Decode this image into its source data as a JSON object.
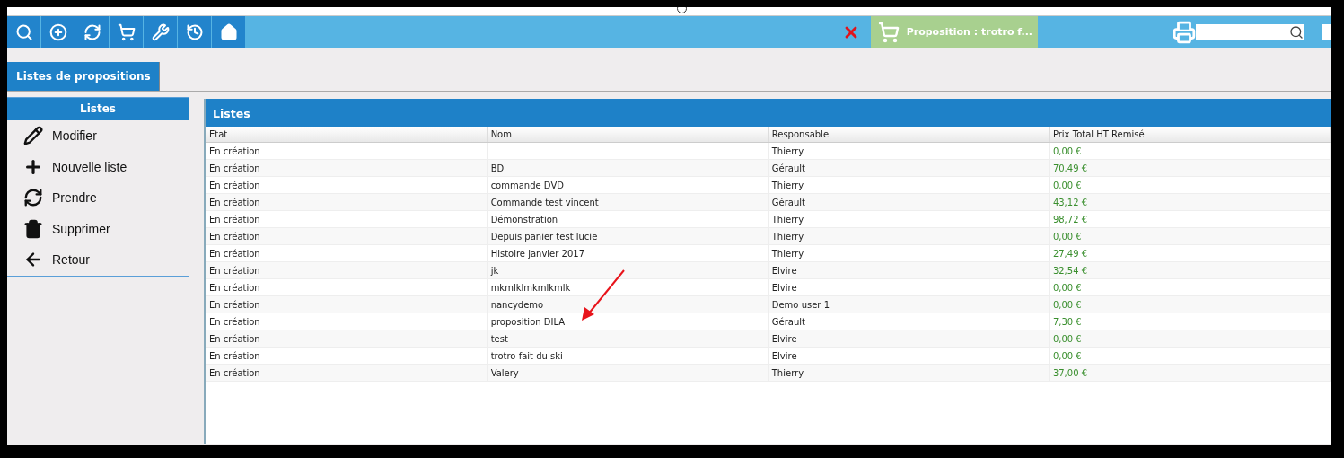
{
  "toolbar": {
    "buttons": [
      {
        "kind": "search"
      },
      {
        "kind": "add"
      },
      {
        "kind": "refresh"
      },
      {
        "kind": "cart"
      },
      {
        "kind": "tools"
      },
      {
        "kind": "history"
      },
      {
        "kind": "home"
      }
    ],
    "proposition": "Proposition : trotro f..."
  },
  "tabs": [
    {
      "label": "Listes de propositions",
      "selected": true
    }
  ],
  "sidebar": {
    "title": "Listes",
    "items": [
      {
        "kind": "edit",
        "label": "Modifier"
      },
      {
        "kind": "add",
        "label": "Nouvelle liste"
      },
      {
        "kind": "refresh",
        "label": "Prendre"
      },
      {
        "kind": "delete",
        "label": "Supprimer"
      },
      {
        "kind": "back",
        "label": "Retour"
      }
    ]
  },
  "table": {
    "title": "Listes",
    "columns": [
      "Etat",
      "Nom",
      "Responsable",
      "Prix Total HT Remisé"
    ],
    "rows": [
      [
        "En création",
        "",
        "Thierry",
        "0,00 €"
      ],
      [
        "En création",
        "BD",
        "Gérault",
        "70,49 €"
      ],
      [
        "En création",
        "commande DVD",
        "Thierry",
        "0,00 €"
      ],
      [
        "En création",
        "Commande test vincent",
        "Gérault",
        "43,12 €"
      ],
      [
        "En création",
        "Démonstration",
        "Thierry",
        "98,72 €"
      ],
      [
        "En création",
        "Depuis panier test lucie",
        "Thierry",
        "0,00 €"
      ],
      [
        "En création",
        "Histoire janvier 2017",
        "Thierry",
        "27,49 €"
      ],
      [
        "En création",
        "jk",
        "Elvire",
        "32,54 €"
      ],
      [
        "En création",
        "mkmlklmkmlkmlk",
        "Elvire",
        "0,00 €"
      ],
      [
        "En création",
        "nancydemo",
        "Demo user 1",
        "0,00 €"
      ],
      [
        "En création",
        "proposition DILA",
        "Gérault",
        "7,30 €"
      ],
      [
        "En création",
        "test",
        "Elvire",
        "0,00 €"
      ],
      [
        "En création",
        "trotro fait du ski",
        "Elvire",
        "0,00 €"
      ],
      [
        "En création",
        "Valery",
        "Thierry",
        "37,00 €"
      ]
    ]
  }
}
